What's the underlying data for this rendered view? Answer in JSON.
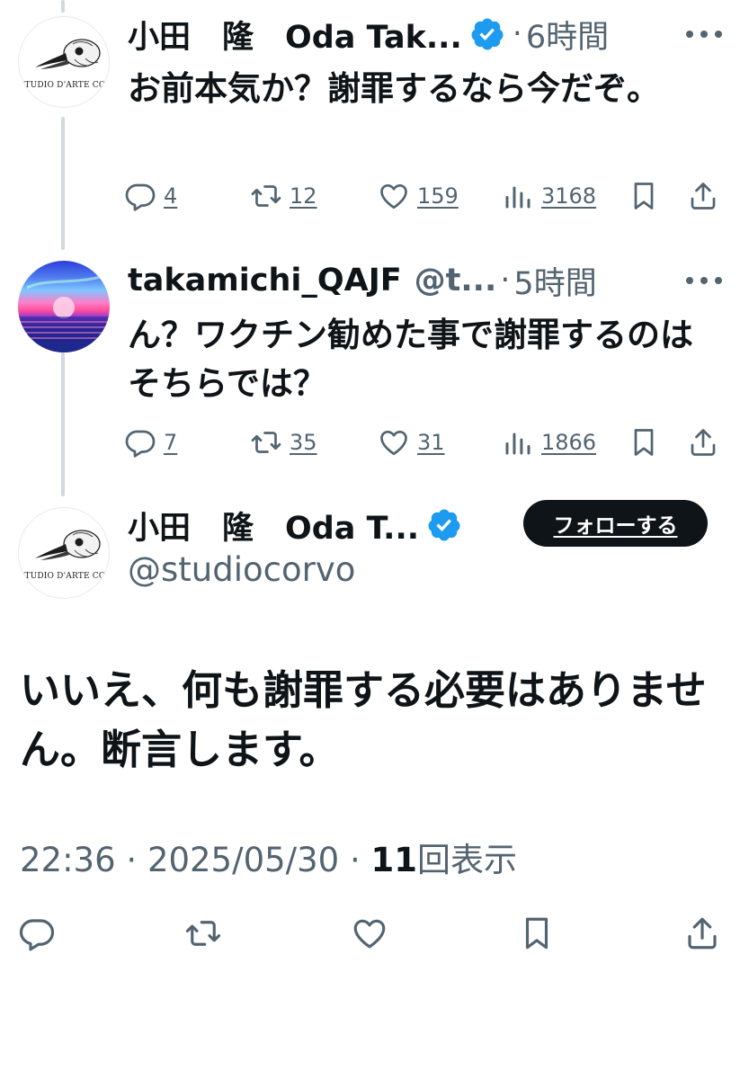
{
  "tweets": [
    {
      "display_name": "小田　隆　Oda Tak...",
      "verified": true,
      "handle": "",
      "separator": "·",
      "time_ago": "6時間",
      "text": "お前本気か？謝罪するなら今だぞ。",
      "avatar_text": "STUDIO D'ARTE CORVO",
      "stats": {
        "replies": "4",
        "retweets": "12",
        "likes": "159",
        "views": "3168"
      }
    },
    {
      "display_name": "takamichi_QAJF",
      "verified": false,
      "handle": "@t...",
      "separator": "·",
      "time_ago": "5時間",
      "text": "ん？ワクチン勧めた事で謝罪するのはそちらでは？",
      "stats": {
        "replies": "7",
        "retweets": "35",
        "likes": "31",
        "views": "1866"
      }
    }
  ],
  "main_tweet": {
    "display_name": "小田　隆　Oda T...",
    "verified": true,
    "handle": "@studiocorvo",
    "follow_label": "フォローする",
    "avatar_text": "STUDIO D'ARTE CORVO",
    "text": "いいえ、何も謝罪する必要はありません。断言します。",
    "time": "22:36",
    "date": "2025/05/30",
    "separator": "·",
    "views_count": "11",
    "views_label": "回表示"
  },
  "icons": {
    "reply": "reply-icon",
    "retweet": "retweet-icon",
    "like": "heart-icon",
    "views": "views-chart-icon",
    "bookmark": "bookmark-icon",
    "share": "share-icon",
    "more": "more-icon",
    "verified": "verified-badge-icon"
  },
  "colors": {
    "text": "#0f1419",
    "secondary": "#536471",
    "verified_blue": "#1d9bf0",
    "thread_line": "#cfd9de",
    "follow_button_bg": "#0f1419"
  }
}
